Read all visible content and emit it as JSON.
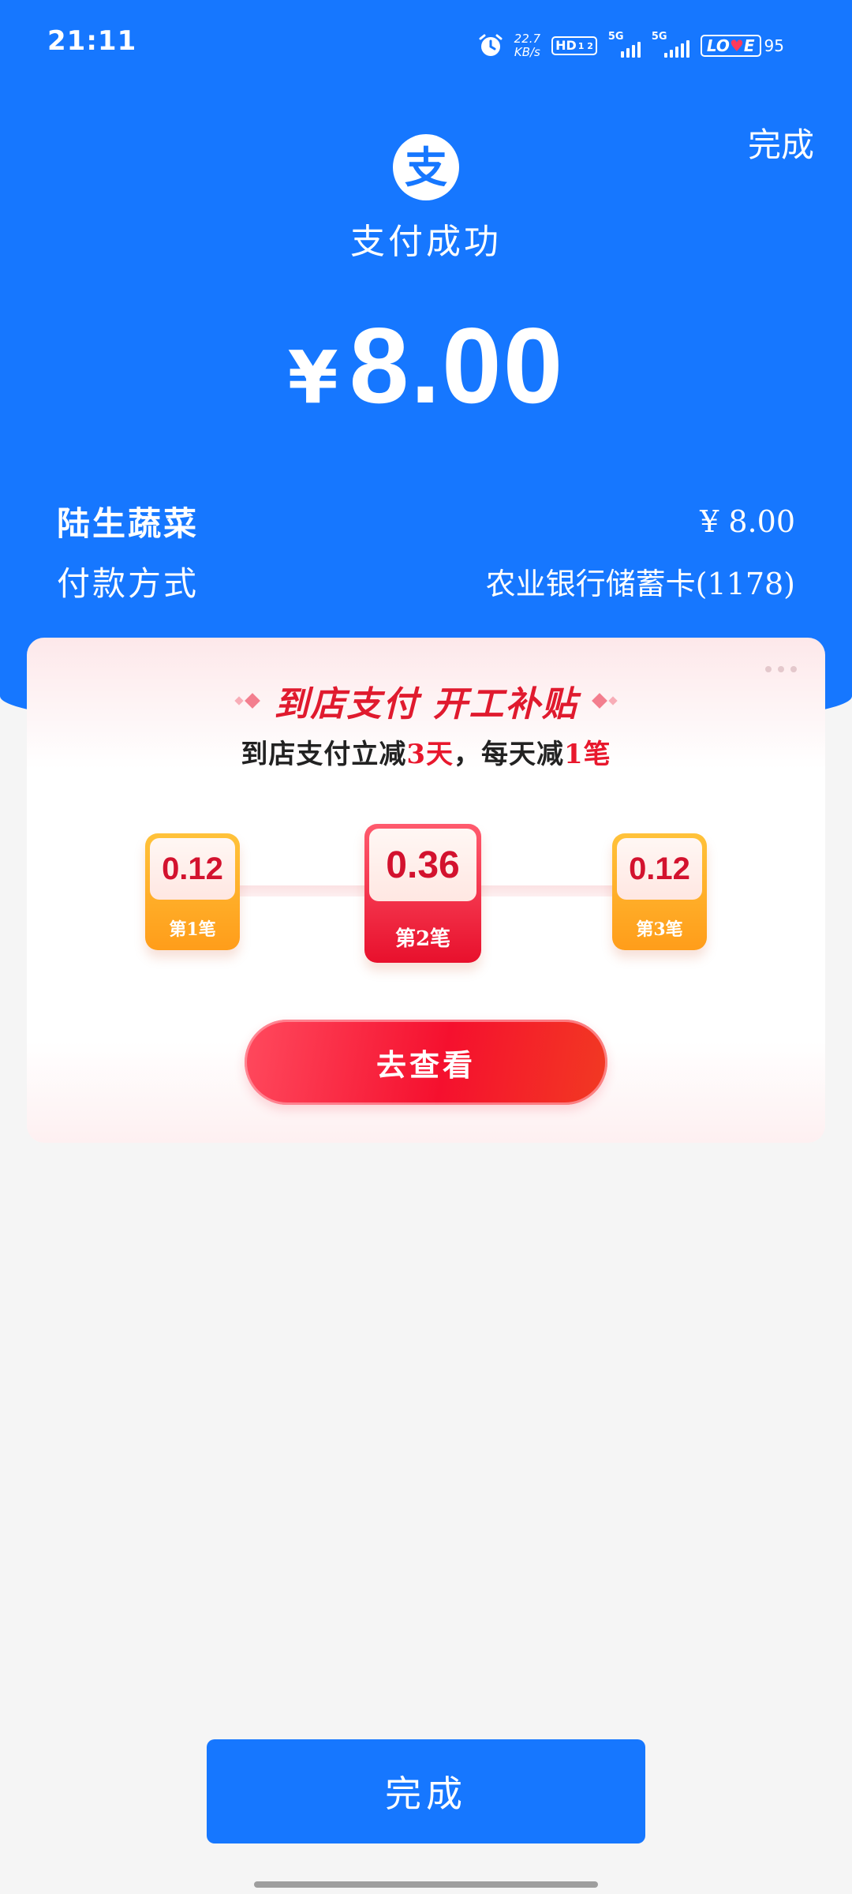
{
  "status_bar": {
    "time": "21:11",
    "net_speed_value": "22.7",
    "net_speed_unit": "KB/s",
    "hd_label": "HD",
    "hd_sub": "1 2",
    "sim1_type": "5G",
    "sim2_type": "5G",
    "battery_brand": "LOVE",
    "battery_level": "95"
  },
  "header": {
    "done_link": "完成",
    "logo_char": "支",
    "title": "支付成功",
    "currency_symbol": "¥",
    "amount": "8.00"
  },
  "details": {
    "merchant_name": "陆生蔬菜",
    "merchant_amount": "¥ 8.00",
    "method_label": "付款方式",
    "method_value": "农业银行储蓄卡(1178)"
  },
  "promo": {
    "title": "到店支付 开工补贴",
    "subtitle_a": "到店支付立减",
    "subtitle_days": "3天",
    "subtitle_b": "，每天减",
    "subtitle_count": "1笔",
    "coupons": [
      {
        "value": "0.12",
        "label": "第1笔"
      },
      {
        "value": "0.36",
        "label": "第2笔"
      },
      {
        "value": "0.12",
        "label": "第3笔"
      }
    ],
    "button_label": "去查看"
  },
  "footer": {
    "done_button": "完成"
  },
  "colors": {
    "brand_blue": "#1677ff",
    "promo_red": "#e8182d",
    "coupon_orange": "#ff9d1a",
    "page_bg": "#f5f5f5"
  },
  "icons": [
    "alarm-icon",
    "hd-voice-icon",
    "signal-icon",
    "battery-icon",
    "alipay-logo-icon",
    "more-icon",
    "diamond-deco-icon"
  ]
}
